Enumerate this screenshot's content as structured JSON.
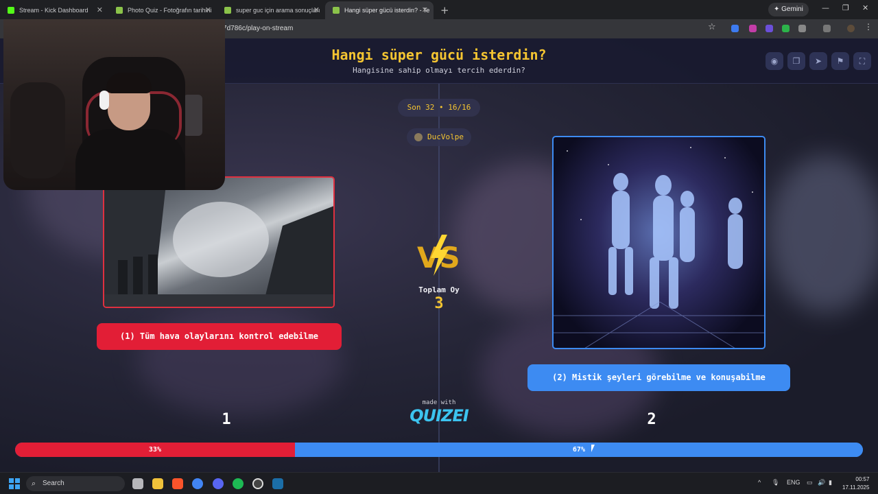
{
  "browser": {
    "tabs": [
      {
        "label": "Stream - Kick Dashboard",
        "icon": "kick-icon",
        "color": "#53fc18"
      },
      {
        "label": "Photo Quiz - Fotoğrafın tarihini",
        "icon": "quiz-icon",
        "color": "#8bc34a"
      },
      {
        "label": "super guc için arama sonuçları",
        "icon": "quiz-icon",
        "color": "#8bc34a"
      },
      {
        "label": "Hangi süper gücü isterdin? - Te",
        "icon": "quiz-icon",
        "color": "#8bc34a"
      }
    ],
    "new_tab": "+",
    "gemini_label": "✦ Gemini",
    "url": "...ba07d786c/play-on-stream"
  },
  "quiz": {
    "title": "Hangi süper gücü isterdin?",
    "subtitle": "Hangisine sahip olmayı tercih ederdin?",
    "round": "Son 32 • 16/16",
    "user": "DucVolpe",
    "vs": "VS",
    "total_label": "Toplam Oy",
    "total_value": "3",
    "option1": {
      "label": "(1) Tüm hava olaylarını kontrol edebilme",
      "number": "1",
      "percent_text": "33%",
      "percent": 33,
      "color": "#e21e36"
    },
    "option2": {
      "label": "(2) Mistik şeyleri görebilme ve konuşabilme",
      "number": "2",
      "percent_text": "67%",
      "percent": 67,
      "color": "#3d8bf2"
    },
    "made_with": "made with",
    "brand": "QUIZEI",
    "accent": "#f5c531"
  },
  "toolbar_icons": [
    "eye-icon",
    "copy-icon",
    "send-icon",
    "flag-icon",
    "fullscreen-icon"
  ],
  "taskbar": {
    "search": "Search",
    "lang": "ENG",
    "time": "00:57",
    "date": "17.11.2025"
  }
}
